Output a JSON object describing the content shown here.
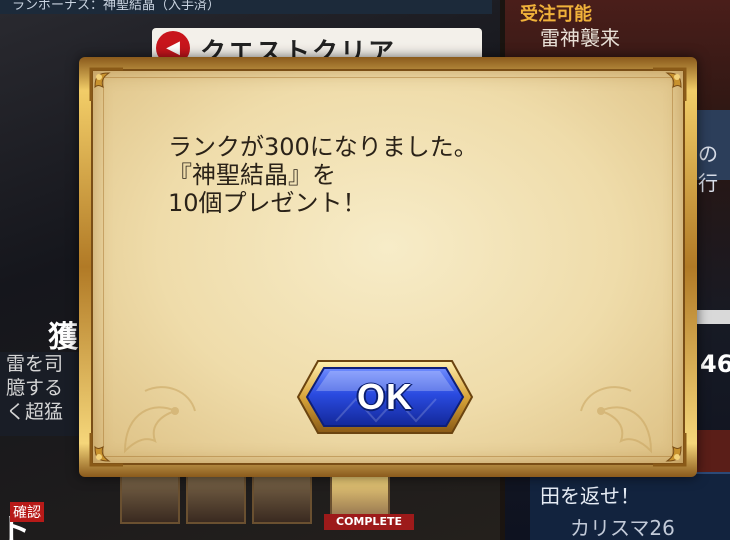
{
  "background": {
    "top_bar_text": "ランボーナス：神聖結晶（入手済）",
    "quest_clear_label": "クエストクリア",
    "right_status_text": "受注可能",
    "right_quest_title": "雷神襲来",
    "right_fragment_text": "の行",
    "right_number_fragment": "46",
    "left_title_fragment": "獲",
    "left_description": [
      "雷を司",
      "臆する",
      "く超猛"
    ],
    "confirm_badge": "確認",
    "left_letter_fragment": "ト",
    "complete_tag": "COMPLETE",
    "bottom_right_line1": "田を返せ！",
    "bottom_right_line2": "カリスマ26"
  },
  "dialog": {
    "message_lines": [
      "ランクが300になりました。",
      "『神聖結晶』を",
      "10個プレゼント！"
    ],
    "ok_label": "OK"
  },
  "colors": {
    "dialog_frame_gold": "#c89a3c",
    "parchment": "#efdcaa",
    "ok_button_blue": "#1e3fd0",
    "ok_button_frame": "#e6b84a",
    "quest_clear_red": "#c8151c"
  },
  "icons": {
    "quest_clear_icon": "megaphone-icon",
    "corner_ornament": "ornament-icon"
  }
}
